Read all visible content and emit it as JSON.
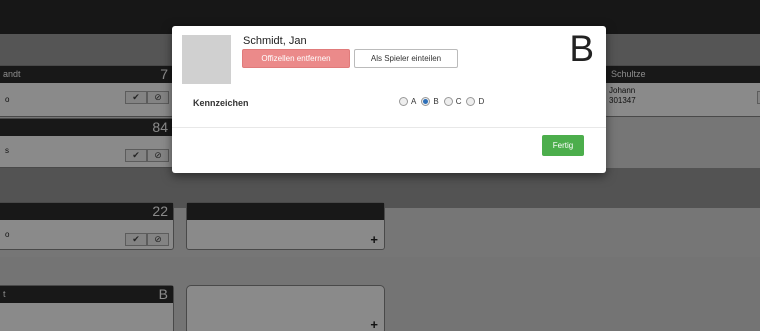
{
  "background": {
    "card1": {
      "head": "andt",
      "number": "7",
      "row_text": "o"
    },
    "card2": {
      "number": "84",
      "row_text": "s"
    },
    "card3": {
      "number": "22",
      "row_text": "o"
    },
    "card4": {
      "head": "t",
      "number": "B"
    },
    "card_right": {
      "head": "Schultze",
      "line1": "Johann",
      "line2": "301347"
    },
    "icons": {
      "check": "✔",
      "ban": "⊘",
      "plus": "+"
    }
  },
  "modal": {
    "name": "Schmidt, Jan",
    "remove_official_label": "Offizellen entfernen",
    "assign_player_label": "Als Spieler einteilen",
    "big_letter": "B",
    "kennzeichen_label": "Kennzeichen",
    "options": [
      "A",
      "B",
      "C",
      "D"
    ],
    "selected_option": "B",
    "done_label": "Fertig"
  },
  "colors": {
    "danger": "#eb8a8a",
    "success": "#4cae4c",
    "accent": "#2d6fb8"
  }
}
